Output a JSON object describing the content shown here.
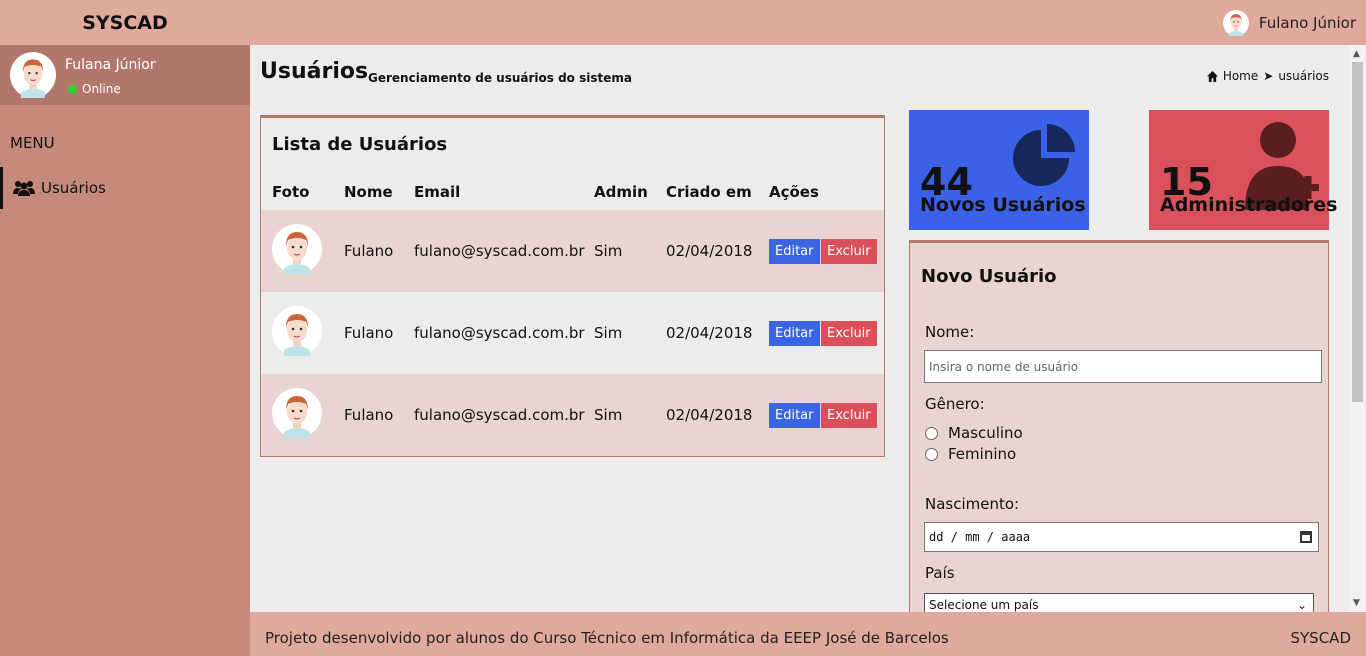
{
  "topbar": {
    "brand": "SYSCAD",
    "user_name": "Fulano Júnior"
  },
  "sidebar": {
    "user_name": "Fulana Júnior",
    "status": "Online",
    "menu_title": "MENU",
    "items": [
      {
        "label": "Usuários",
        "icon": "users-icon"
      }
    ]
  },
  "header": {
    "title": "Usuários",
    "subtitle": "Gerenciamento de usuários do sistema",
    "breadcrumb": {
      "home": "Home",
      "current": "usuários"
    }
  },
  "user_list": {
    "title": "Lista de Usuários",
    "columns": [
      "Foto",
      "Nome",
      "Email",
      "Admin",
      "Criado em",
      "Ações"
    ],
    "rows": [
      {
        "name": "Fulano",
        "email": "fulano@syscad.com.br",
        "admin": "Sim",
        "created": "02/04/2018"
      },
      {
        "name": "Fulano",
        "email": "fulano@syscad.com.br",
        "admin": "Sim",
        "created": "02/04/2018"
      },
      {
        "name": "Fulano",
        "email": "fulano@syscad.com.br",
        "admin": "Sim",
        "created": "02/04/2018"
      }
    ],
    "edit_label": "Editar",
    "delete_label": "Excluir"
  },
  "stats": {
    "new_users": {
      "value": "44",
      "label": "Novos Usuários",
      "color": "#3b61e6"
    },
    "admins": {
      "value": "15",
      "label": "Administradores",
      "color": "#d9515a"
    }
  },
  "form": {
    "title": "Novo Usuário",
    "name_label": "Nome:",
    "name_placeholder": "Insira o nome de usuário",
    "gender_label": "Gênero:",
    "gender_options": [
      "Masculino",
      "Feminino"
    ],
    "birth_label": "Nascimento:",
    "birth_placeholder": "dd / mm / aaaa",
    "country_label": "País",
    "country_selected": "Selecione um país"
  },
  "footer": {
    "text": "Projeto desenvolvido por alunos do Curso Técnico em Informática da EEEP José de Barcelos",
    "brand": "SYSCAD"
  }
}
